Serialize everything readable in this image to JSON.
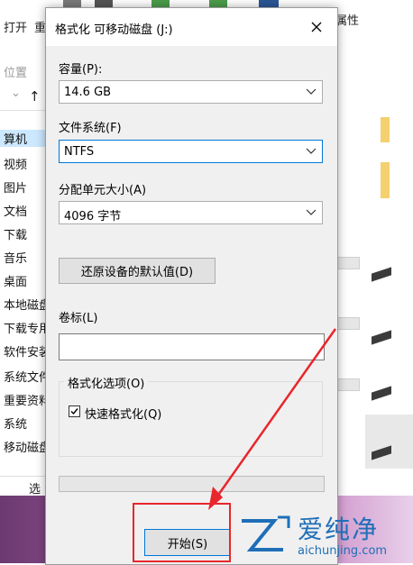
{
  "explorer": {
    "ribbon_open": "打开",
    "ribbon_rename": "重",
    "ribbon_props": "属性",
    "ribbon_location": "位置",
    "nav_items": [
      "算机",
      "视频",
      "图片",
      "文档",
      "下载",
      "音乐",
      "桌面",
      "本地磁盘",
      "下载专用",
      "软件安装",
      "系统文件",
      "重要资料",
      "系统",
      "移动磁盘"
    ],
    "status_label": "选"
  },
  "dialog": {
    "title": "格式化 可移动磁盘 (J:)",
    "capacity_label": "容量(P):",
    "capacity_value": "14.6 GB",
    "filesystem_label": "文件系统(F)",
    "filesystem_value": "NTFS",
    "allocation_label": "分配单元大小(A)",
    "allocation_value": "4096 字节",
    "restore_defaults_label": "还原设备的默认值(D)",
    "volume_label_label": "卷标(L)",
    "volume_label_value": "",
    "format_options_label": "格式化选项(O)",
    "quick_format_label": "快速格式化(Q)",
    "quick_format_checked": true,
    "progress": 0,
    "start_label": "开始(S)"
  },
  "colors": {
    "accent": "#0078d7",
    "annotation": "#e8262b",
    "watermark": "#1f6fb8"
  },
  "watermark": {
    "name": "爱纯净",
    "url": "aichunjing.com"
  }
}
